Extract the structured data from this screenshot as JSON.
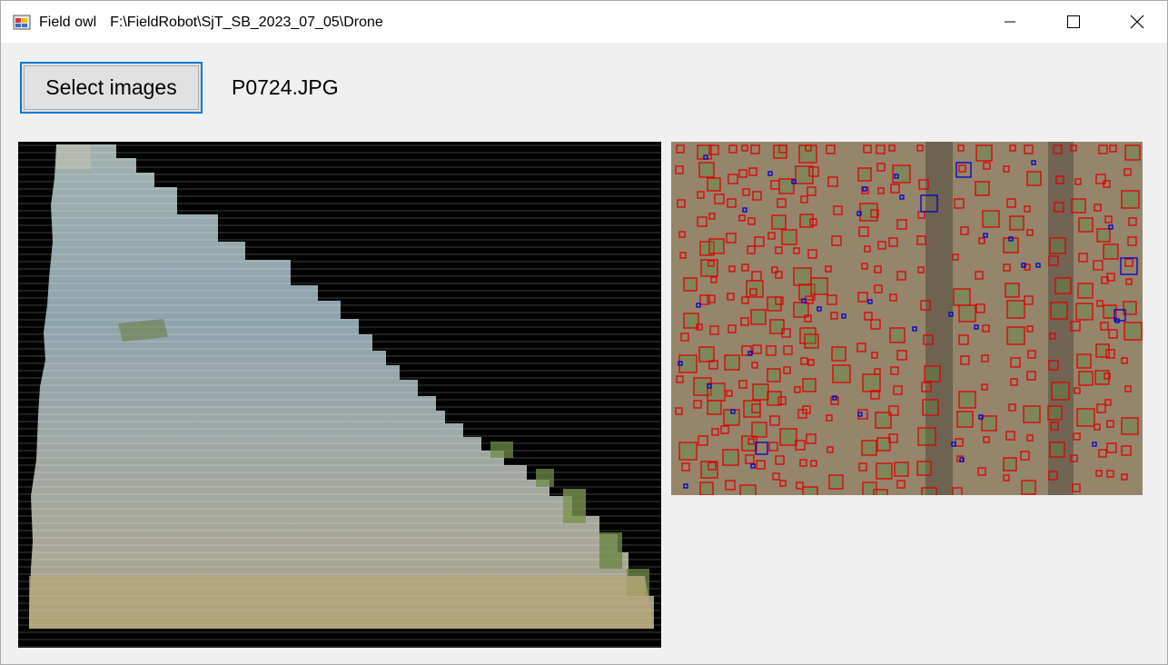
{
  "window": {
    "app_name": "Field owl",
    "path": "F:\\FieldRobot\\SjT_SB_2023_07_05\\Drone",
    "icons": {
      "app": "app-icon",
      "minimize": "minimize-icon",
      "maximize": "maximize-icon",
      "close": "close-icon"
    }
  },
  "toolbar": {
    "select_label": "Select images",
    "current_file": "P0724.JPG"
  },
  "colors": {
    "accent_border": "#0078d7",
    "detection_red": "#e00000",
    "detection_blue": "#0000d0",
    "soil": "#8f8167"
  }
}
